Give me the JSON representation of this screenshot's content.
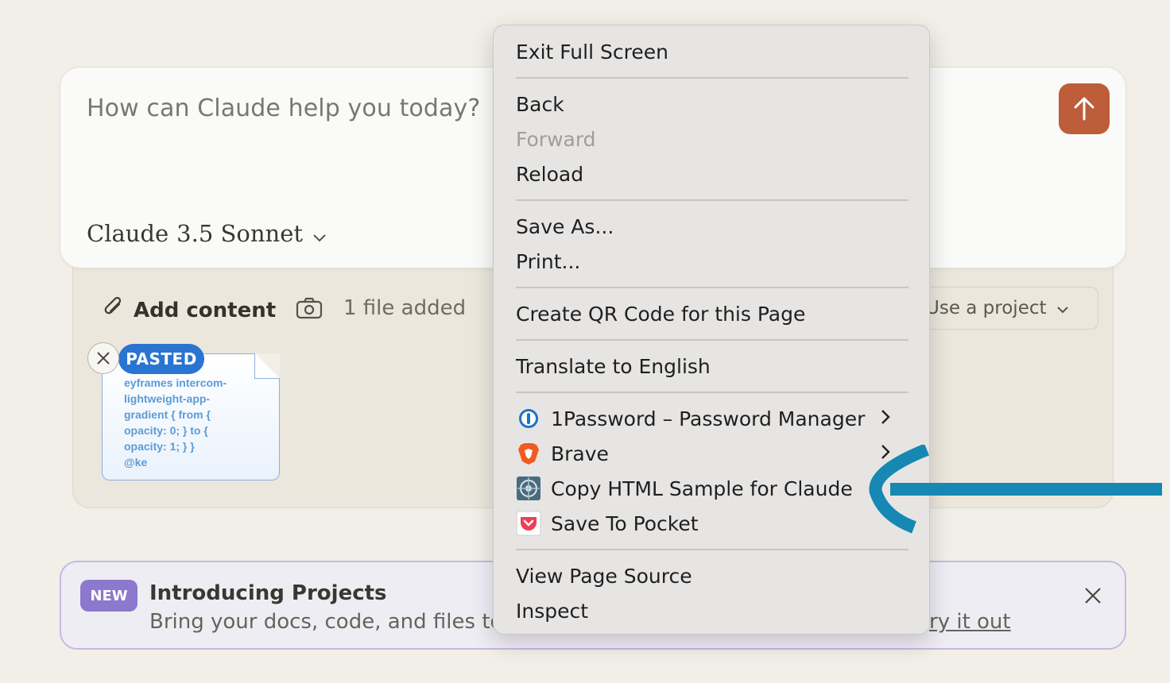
{
  "composer": {
    "placeholder": "How can Claude help you today?",
    "model_name": "Claude",
    "model_version": "3.5 Sonnet",
    "send_color": "#bd5d3a"
  },
  "tray": {
    "add_content_label": "Add content",
    "files_added": "1 file added",
    "use_project_label": "Use a project",
    "pasted_snippet": "eyframes intercom-\nlightweight-app-\ngradient { from {\nopacity: 0; } to {\nopacity: 1; } }\n@ke",
    "pasted_badge": "PASTED"
  },
  "banner": {
    "badge": "NEW",
    "title": "Introducing Projects",
    "description": "Bring your docs, code, and files to",
    "link": "ry it out"
  },
  "menu": {
    "items": [
      {
        "label": "Exit Full Screen"
      },
      {
        "label": "Back"
      },
      {
        "label": "Forward",
        "disabled": true
      },
      {
        "label": "Reload"
      },
      {
        "label": "Save As..."
      },
      {
        "label": "Print..."
      },
      {
        "label": "Create QR Code for this Page"
      },
      {
        "label": "Translate to English"
      },
      {
        "label": "1Password – Password Manager",
        "icon": "1password-icon",
        "submenu": true
      },
      {
        "label": "Brave",
        "icon": "brave-icon",
        "submenu": true
      },
      {
        "label": "Copy HTML Sample for Claude",
        "icon": "extension-icon"
      },
      {
        "label": "Save To Pocket",
        "icon": "pocket-icon"
      },
      {
        "label": "View Page Source"
      },
      {
        "label": "Inspect"
      }
    ]
  },
  "colors": {
    "accent_arrow": "#1688b3",
    "new_badge": "#8c78cc",
    "pasted_badge": "#2a74d2"
  }
}
